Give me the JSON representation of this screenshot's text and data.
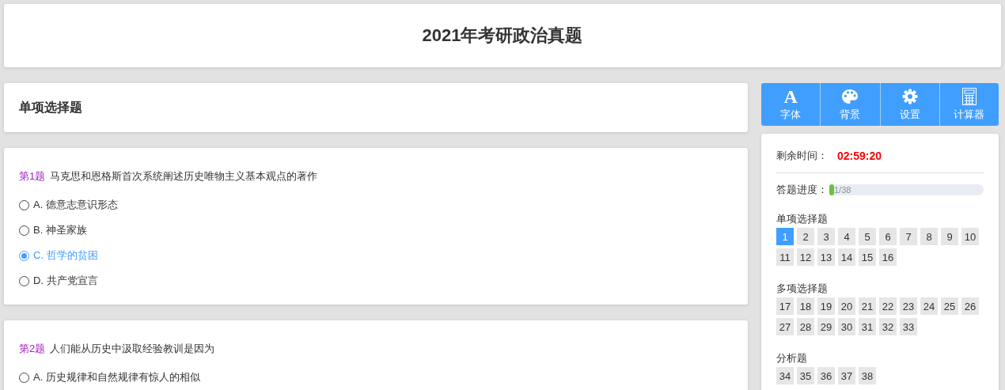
{
  "header": {
    "title": "2021年考研政治真题"
  },
  "section": {
    "title": "单项选择题"
  },
  "questions": [
    {
      "number": "第1题",
      "text": "马克思和恩格斯首次系统阐述历史唯物主义基本观点的著作",
      "options": [
        {
          "label": "A. 德意志意识形态",
          "selected": false
        },
        {
          "label": "B. 神圣家族",
          "selected": false
        },
        {
          "label": "C. 哲学的贫困",
          "selected": true
        },
        {
          "label": "D. 共产党宣言",
          "selected": false
        }
      ]
    },
    {
      "number": "第2题",
      "text": "人们能从历史中汲取经验教训是因为",
      "options": [
        {
          "label": "A. 历史规律和自然规律有惊人的相似",
          "selected": false
        }
      ]
    }
  ],
  "toolbar": [
    {
      "kind": "font",
      "glyph": "A",
      "label": "字体"
    },
    {
      "kind": "palette",
      "label": "背景"
    },
    {
      "kind": "gear",
      "label": "设置"
    },
    {
      "kind": "calculator",
      "label": "计算器"
    }
  ],
  "timer": {
    "label": "剩余时间：",
    "value": "02:59:20"
  },
  "progress": {
    "label": "答题进度：",
    "level": 0.03,
    "reading": "1/38"
  },
  "navigator": [
    {
      "title": "单项选择题",
      "items": [
        {
          "number": "1",
          "selected": true
        },
        {
          "number": "2",
          "selected": false
        },
        {
          "number": "3",
          "selected": false
        },
        {
          "number": "4",
          "selected": false
        },
        {
          "number": "5",
          "selected": false
        },
        {
          "number": "6",
          "selected": false
        },
        {
          "number": "7",
          "selected": false
        },
        {
          "number": "8",
          "selected": false
        },
        {
          "number": "9",
          "selected": false
        },
        {
          "number": "10",
          "selected": false
        },
        {
          "number": "11",
          "selected": false
        },
        {
          "number": "12",
          "selected": false
        },
        {
          "number": "13",
          "selected": false
        },
        {
          "number": "14",
          "selected": false
        },
        {
          "number": "15",
          "selected": false
        },
        {
          "number": "16",
          "selected": false
        }
      ]
    },
    {
      "title": "多项选择题",
      "items": [
        {
          "number": "17",
          "selected": false
        },
        {
          "number": "18",
          "selected": false
        },
        {
          "number": "19",
          "selected": false
        },
        {
          "number": "20",
          "selected": false
        },
        {
          "number": "21",
          "selected": false
        },
        {
          "number": "22",
          "selected": false
        },
        {
          "number": "23",
          "selected": false
        },
        {
          "number": "24",
          "selected": false
        },
        {
          "number": "25",
          "selected": false
        },
        {
          "number": "26",
          "selected": false
        },
        {
          "number": "27",
          "selected": false
        },
        {
          "number": "28",
          "selected": false
        },
        {
          "number": "29",
          "selected": false
        },
        {
          "number": "30",
          "selected": false
        },
        {
          "number": "31",
          "selected": false
        },
        {
          "number": "32",
          "selected": false
        },
        {
          "number": "33",
          "selected": false
        }
      ]
    },
    {
      "title": "分析题",
      "items": [
        {
          "number": "34",
          "selected": false
        },
        {
          "number": "35",
          "selected": false
        },
        {
          "number": "36",
          "selected": false
        },
        {
          "number": "37",
          "selected": false
        },
        {
          "number": "38",
          "selected": false
        }
      ]
    }
  ]
}
